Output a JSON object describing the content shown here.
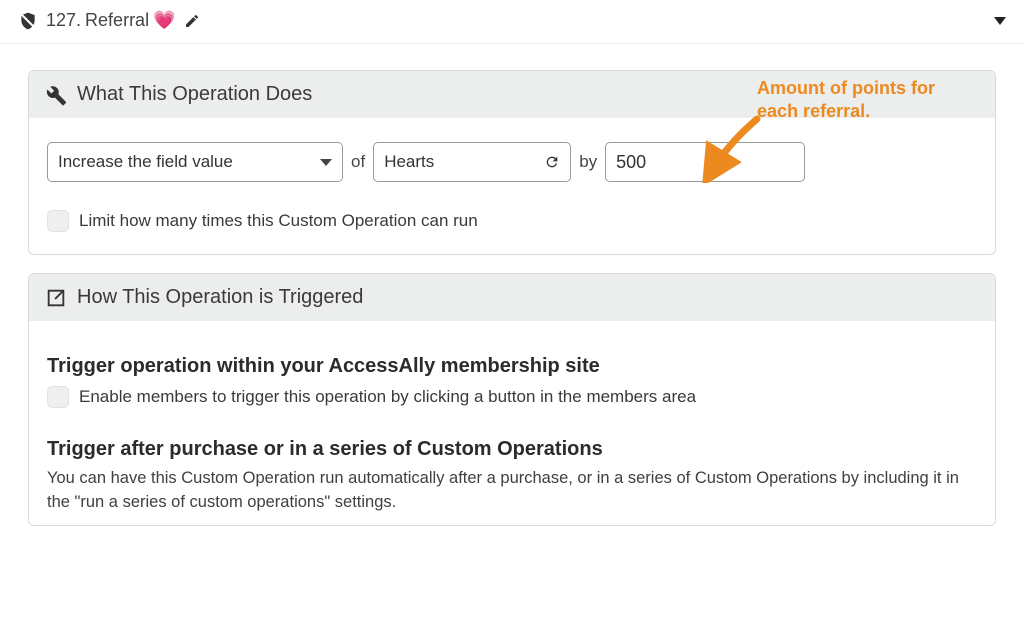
{
  "header": {
    "number": "127.",
    "title": "Referral",
    "heart_emoji": "💗"
  },
  "panel1": {
    "title": "What This Operation Does",
    "action_select": "Increase the field value",
    "of_label": "of",
    "field_select": "Hearts",
    "by_label": "by",
    "amount_value": "500",
    "limit_checkbox_label": "Limit how many times this Custom Operation can run",
    "annotation_line1": "Amount of points for",
    "annotation_line2": "each referral."
  },
  "panel2": {
    "title": "How This Operation is Triggered",
    "sub1_heading": "Trigger operation within your AccessAlly membership site",
    "sub1_checkbox_label": "Enable members to trigger this operation by clicking a button in the members area",
    "sub2_heading": "Trigger after purchase or in a series of Custom Operations",
    "sub2_desc": "You can have this Custom Operation run automatically after a purchase, or in a series of Custom Operations by including it in the \"run a series of custom operations\" settings."
  }
}
